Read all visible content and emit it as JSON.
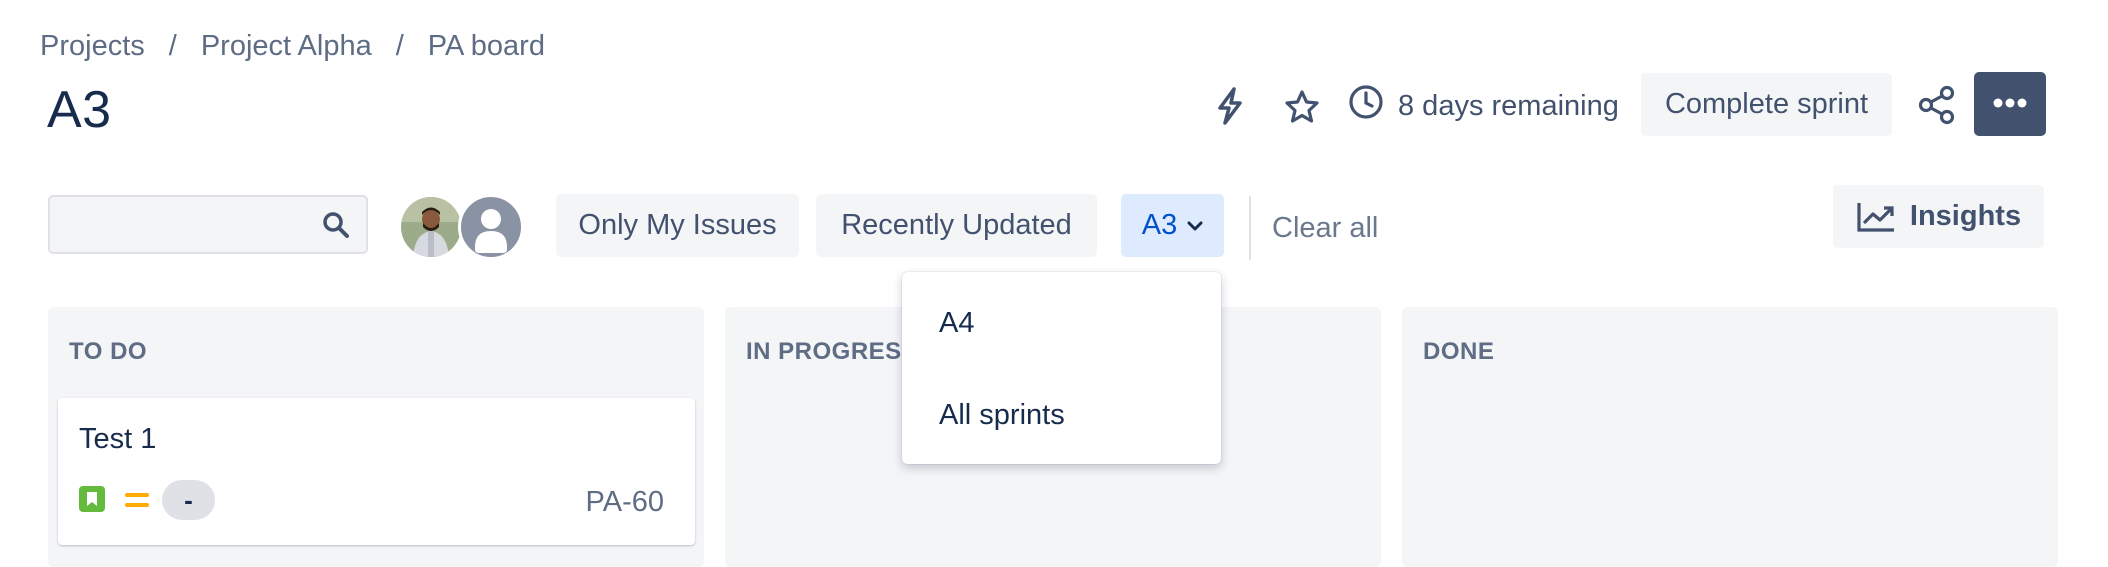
{
  "breadcrumb": {
    "items": [
      "Projects",
      "Project Alpha",
      "PA board"
    ],
    "separator": "/"
  },
  "page_title": "A3",
  "header_actions": {
    "automation_icon": "lightning-icon",
    "star_icon": "star-icon",
    "clock_icon": "clock-icon",
    "remaining_text": "8 days remaining",
    "complete_sprint_label": "Complete sprint",
    "share_icon": "share-icon",
    "more_icon": "more-dots-icon"
  },
  "filters": {
    "search": {
      "value": "",
      "placeholder": "",
      "icon": "search-icon"
    },
    "avatars": [
      "user-avatar-photo",
      "default-avatar"
    ],
    "only_my_issues": "Only My Issues",
    "recently_updated": "Recently Updated",
    "sprint_select": "A3",
    "clear_all": "Clear all",
    "insights": "Insights"
  },
  "sprint_dropdown": {
    "options": [
      "A4",
      "All sprints"
    ]
  },
  "columns": [
    {
      "title": "TO DO"
    },
    {
      "title": "IN PROGRESS"
    },
    {
      "title": "DONE"
    }
  ],
  "cards": [
    {
      "summary": "Test 1",
      "type_icon": "story-icon",
      "priority_icon": "priority-medium-icon",
      "estimate": "-",
      "key": "PA-60"
    }
  ],
  "colors": {
    "text_primary": "#172b4d",
    "text_secondary": "#5e6c84",
    "button_bg": "#f4f5f7",
    "selected_bg": "#deebff",
    "selected_text": "#0052cc",
    "more_button_bg": "#42526e",
    "story_green": "#63ba3c",
    "priority_orange": "#ffab00"
  }
}
